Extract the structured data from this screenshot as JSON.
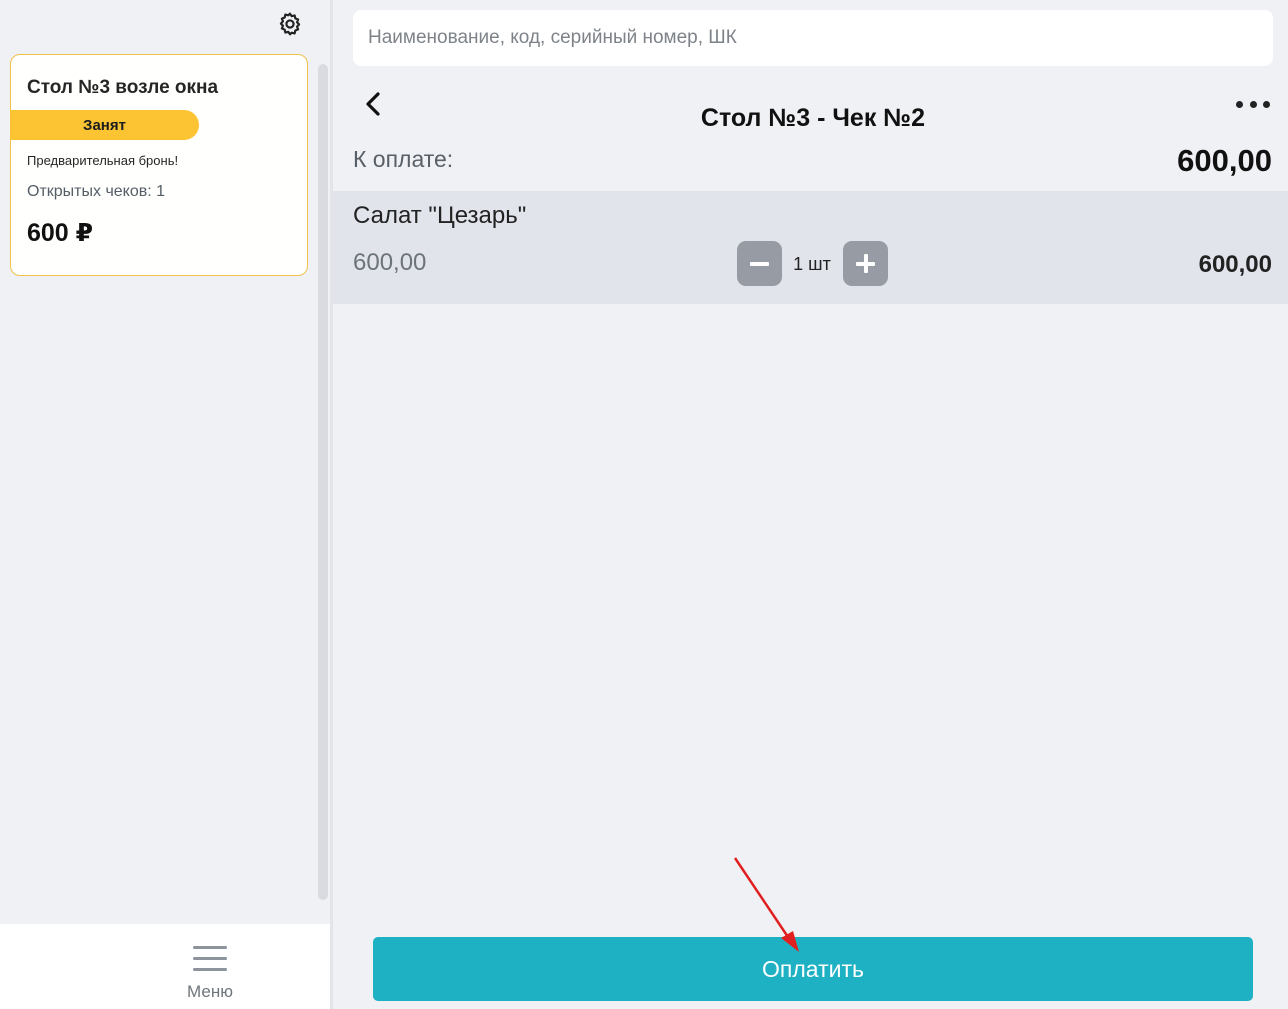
{
  "sidebar": {
    "table_card": {
      "title": "Стол №3 возле окна",
      "status": "Занят",
      "note": "Предварительная бронь!",
      "open_checks": "Открытых чеков: 1",
      "total": "600 ₽"
    },
    "bottom_menu_label": "Меню"
  },
  "search": {
    "placeholder": "Наименование, код, серийный номер, ШК",
    "value": ""
  },
  "check": {
    "title": "Стол №3 - Чек №2",
    "pay_label": "К оплате:",
    "pay_amount": "600,00",
    "items": [
      {
        "name": "Салат \"Цезарь\"",
        "price": "600,00",
        "quantity": "1 шт",
        "sum": "600,00"
      }
    ]
  },
  "actions": {
    "pay_button_label": "Оплатить"
  },
  "colors": {
    "status_busy": "#fcc433",
    "accent": "#1eb1c3",
    "annotation_arrow": "#e02020"
  },
  "icons": {
    "settings": "gear-icon",
    "back": "chevron-left-icon",
    "more": "more-horizontal-icon",
    "menu": "hamburger-icon",
    "minus": "minus-icon",
    "plus": "plus-icon"
  }
}
